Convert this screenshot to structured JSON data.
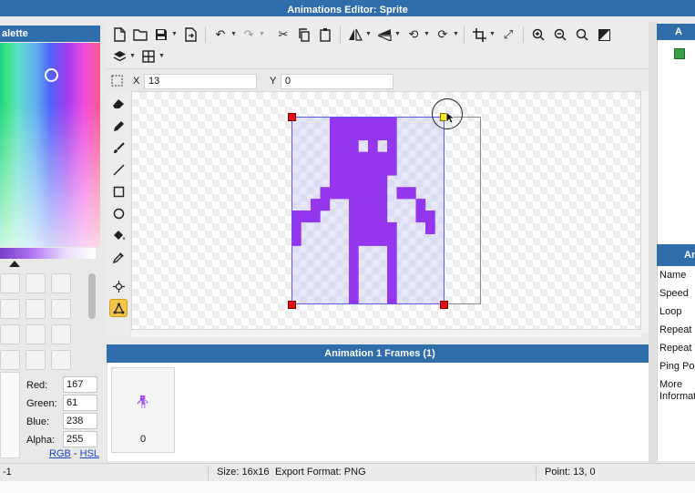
{
  "window": {
    "title": "Animations Editor: Sprite"
  },
  "palette": {
    "header": "alette",
    "color": {
      "red": "167",
      "green": "61",
      "blue": "238",
      "alpha": "255"
    },
    "labels": {
      "red": "Red:",
      "green": "Green:",
      "blue": "Blue:",
      "alpha": "Alpha:"
    },
    "format_rgb": "RGB",
    "format_sep": "-",
    "format_hsl": "HSL"
  },
  "toolbar": {
    "icons": [
      "new-icon",
      "open-icon",
      "save-icon",
      "export-icon",
      "undo-icon",
      "redo-icon",
      "cut-icon",
      "copy-icon",
      "paste-icon",
      "flip-horizontal-icon",
      "flip-vertical-icon",
      "rotate-left-icon",
      "rotate-right-icon",
      "crop-icon",
      "resize-icon",
      "zoom-in-icon",
      "zoom-out-icon",
      "zoom-fit-icon",
      "toggle-background-icon",
      "layers-icon",
      "grid-icon"
    ]
  },
  "coords": {
    "x_label": "X",
    "x_value": "13",
    "y_label": "Y",
    "y_value": "0"
  },
  "tools": [
    "eraser-icon",
    "pencil-icon",
    "brush-icon",
    "line-icon",
    "rectangle-icon",
    "ellipse-icon",
    "fill-icon",
    "eyedropper-icon",
    "target-icon",
    "transform-icon"
  ],
  "sprite": {
    "color": "#9336ee"
  },
  "frames": {
    "header": "Animation 1 Frames (1)",
    "items": [
      {
        "label": "0"
      }
    ]
  },
  "right_panel": {
    "section_header": "A",
    "props_header": "Ani",
    "properties": [
      "Name",
      "Speed",
      "Loop",
      "Repeat C",
      "Repeat T",
      "Ping Pon",
      "More",
      "Informati"
    ]
  },
  "status": {
    "left": "-1",
    "size": "Size: 16x16",
    "export_format": "Export Format: PNG",
    "point": "Point: 13, 0"
  }
}
